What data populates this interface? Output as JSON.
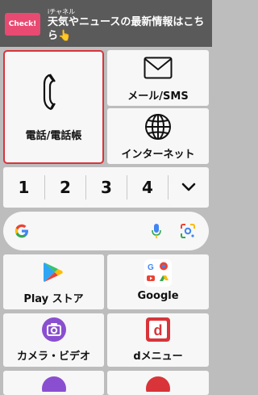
{
  "banner": {
    "badge": "Check!",
    "channel": "iチャネル",
    "title": "天気やニュースの最新情報はこちら👆"
  },
  "tiles": {
    "phone_label": "電話/電話帳",
    "mail_label": "メール/SMS",
    "internet_label": "インターネット",
    "play_label": "Play ストア",
    "google_label": "Google",
    "camera_label": "カメラ・ビデオ",
    "dmenu_label": "dメニュー"
  },
  "numbers": [
    "1",
    "2",
    "3",
    "4"
  ],
  "colors": {
    "highlight_border": "#d8343a",
    "banner_badge": "#e84a72",
    "camera_icon": "#8a4fd0",
    "dmenu_icon": "#d8343a"
  }
}
